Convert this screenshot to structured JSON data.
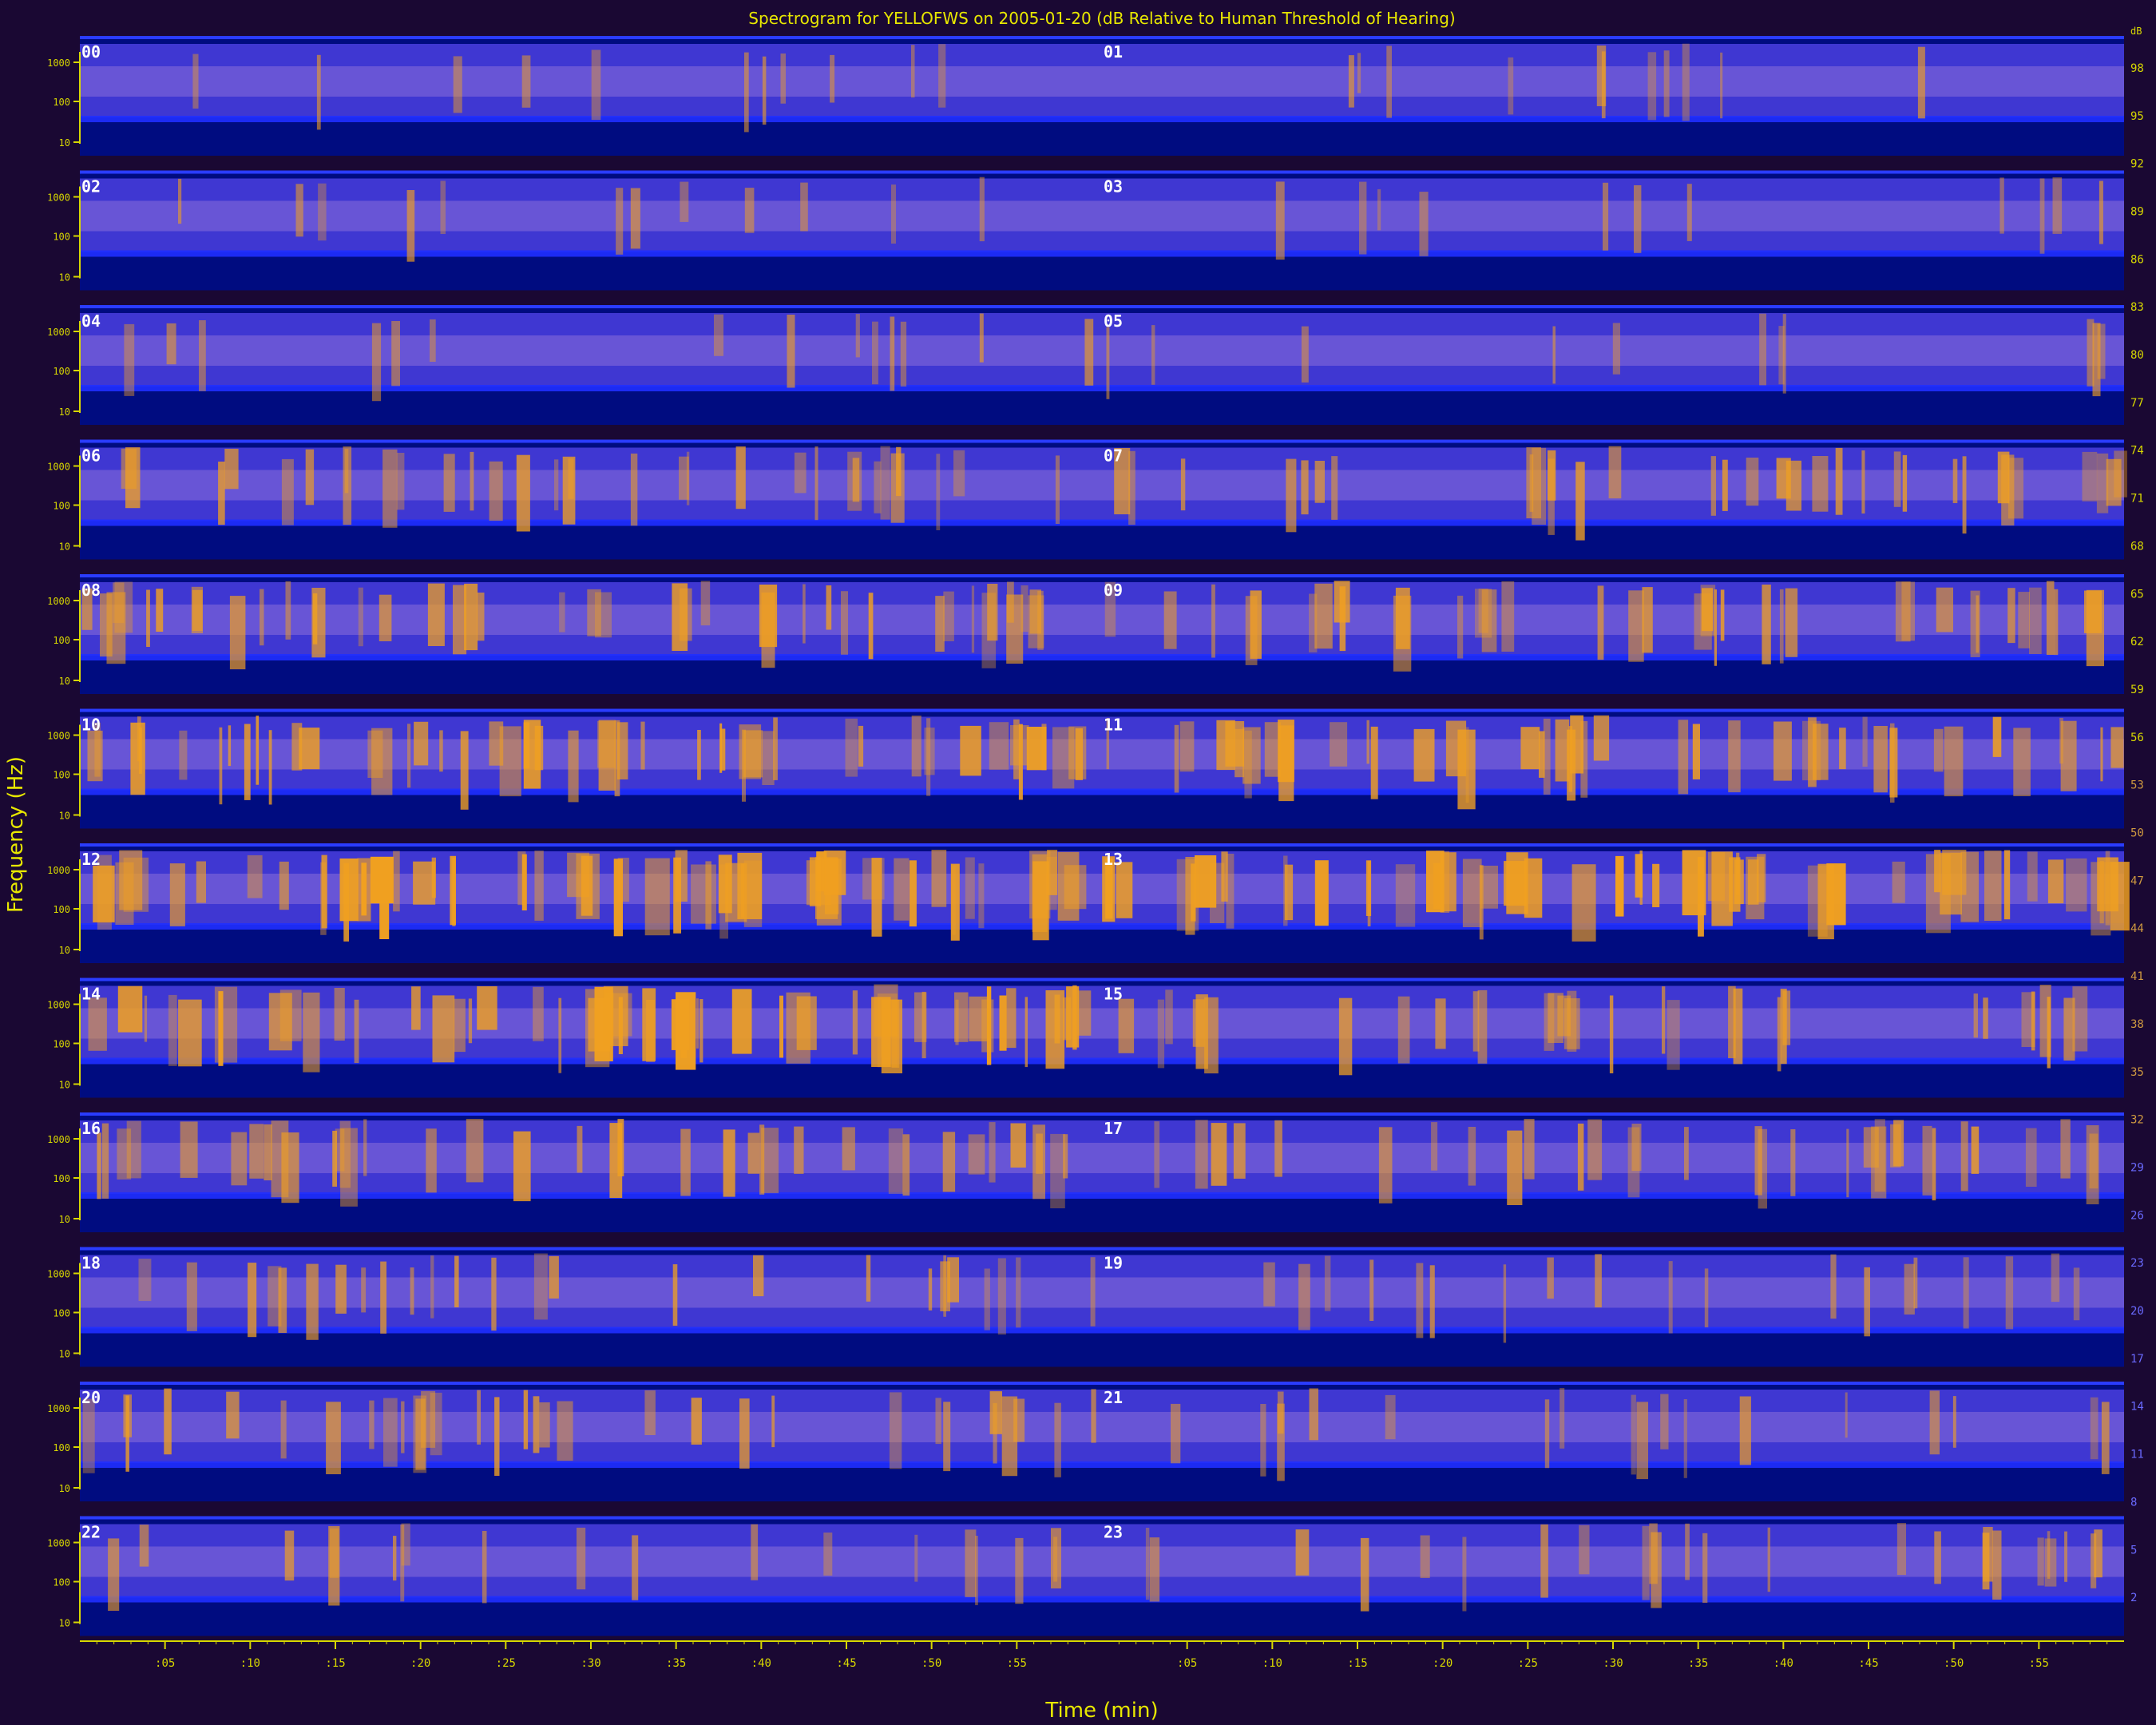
{
  "chart_data": {
    "type": "heatmap",
    "title": "Spectrogram for YELLOFWS on 2005-01-20 (dB Relative to Human Threshold of Hearing)",
    "xlabel": "Time (min)",
    "ylabel": "Frequency (Hz)",
    "x_tick_labels": [
      ":05",
      ":10",
      ":15",
      ":20",
      ":25",
      ":30",
      ":35",
      ":40",
      ":45",
      ":50",
      ":55"
    ],
    "y_tick_labels": [
      "1000",
      "100",
      "10"
    ],
    "hour_labels": [
      "00",
      "01",
      "02",
      "03",
      "04",
      "05",
      "06",
      "07",
      "08",
      "09",
      "10",
      "11",
      "12",
      "13",
      "14",
      "15",
      "16",
      "17",
      "18",
      "19",
      "20",
      "21",
      "22",
      "23"
    ],
    "colorbar_ticks": [
      "98",
      "95",
      "92",
      "89",
      "86",
      "83",
      "80",
      "77",
      "74",
      "71",
      "68",
      "65",
      "62",
      "59",
      "56",
      "53",
      "50",
      "47",
      "44",
      "41",
      "38",
      "35",
      "32",
      "29",
      "26",
      "23",
      "20",
      "17",
      "14",
      "11",
      "8",
      "5",
      "2"
    ],
    "colorbar_range": [
      0,
      100
    ],
    "activity_level_by_hour": [
      0.1,
      0.1,
      0.12,
      0.1,
      0.14,
      0.1,
      0.4,
      0.42,
      0.55,
      0.5,
      0.7,
      0.62,
      0.85,
      0.8,
      0.78,
      0.4,
      0.48,
      0.4,
      0.32,
      0.22,
      0.42,
      0.2,
      0.22,
      0.3
    ],
    "colors": {
      "background": "#1a0833",
      "low": "#000c80",
      "mid": "#4a3fe0",
      "high": "#f0a020",
      "axis": "#d8d800",
      "label": "#ffffff"
    }
  }
}
